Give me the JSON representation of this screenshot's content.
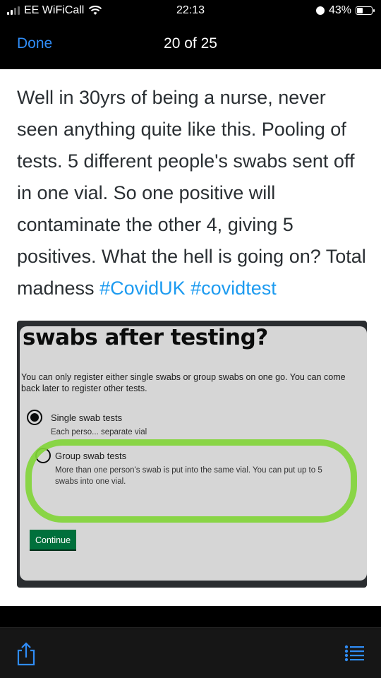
{
  "status_bar": {
    "carrier": "EE WiFiCall",
    "time": "22:13",
    "battery_text": "43%",
    "battery_level": 0.43
  },
  "nav": {
    "done_label": "Done",
    "counter": "20 of 25"
  },
  "tweet": {
    "text": "Well in 30yrs of being a nurse, never seen anything quite like this. Pooling of tests. 5 different people's swabs sent off in one vial. So one positive will contaminate the other 4, giving 5 positives. What the hell is going on? Total madness ",
    "hashtags": [
      "#CovidUK",
      "#covidtest"
    ]
  },
  "photo": {
    "heading": "swabs after testing?",
    "hint": "You can only register either single swabs or group swabs on one go. You can come back later to register other tests.",
    "options": [
      {
        "label": "Single swab tests",
        "hint": "Each perso... separate vial",
        "selected": true
      },
      {
        "label": "Group swab tests",
        "hint": "More than one person's swab is put into the same vial. You can put up to 5 swabs into one vial.",
        "selected": false
      }
    ],
    "continue_label": "Continue",
    "highlight_color": "#82d53a"
  },
  "toolbar": {
    "icons": [
      "share-icon",
      "list-icon"
    ],
    "accent": "#2f8cf7"
  }
}
